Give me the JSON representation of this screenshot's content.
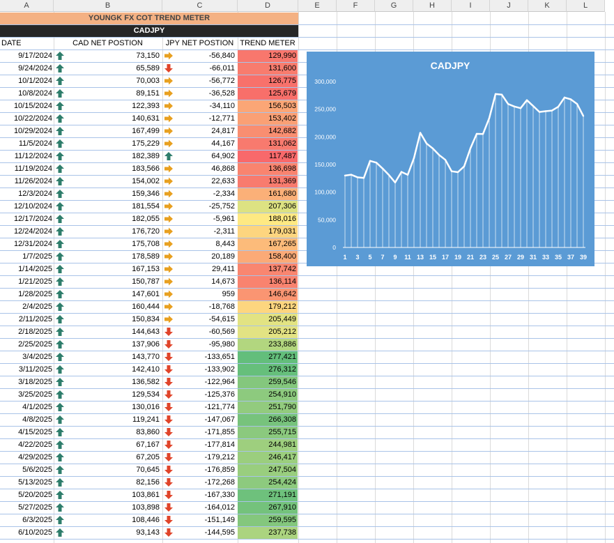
{
  "columns": [
    "A",
    "B",
    "C",
    "D",
    "E",
    "F",
    "G",
    "H",
    "I",
    "J",
    "K",
    "L"
  ],
  "title": "YOUNGK FX COT TREND METER",
  "pair": "CADJPY",
  "headers": {
    "date": "DATE",
    "cad": "CAD NET POSTION",
    "jpy": "JPY NET POSTION",
    "trend": "TREND METER"
  },
  "colors": {
    "up_arrow": "#2e7d6b",
    "down_arrow": "#e0442a",
    "side_arrow": "#e8a020",
    "chart_bg": "#5b9bd5",
    "title_bg": "#f4b183",
    "pair_bg": "#262626"
  },
  "rows": [
    {
      "date": "9/17/2024",
      "cad": "73,150",
      "cad_icon": "up",
      "jpy": "-56,840",
      "jpy_icon": "side",
      "trend": "129,990",
      "trend_color": "#f8776d"
    },
    {
      "date": "9/24/2024",
      "cad": "65,589",
      "cad_icon": "up",
      "jpy": "-66,011",
      "jpy_icon": "down",
      "trend": "131,600",
      "trend_color": "#f87c6e"
    },
    {
      "date": "10/1/2024",
      "cad": "70,003",
      "cad_icon": "up",
      "jpy": "-56,772",
      "jpy_icon": "side",
      "trend": "126,775",
      "trend_color": "#f8716b"
    },
    {
      "date": "10/8/2024",
      "cad": "89,151",
      "cad_icon": "up",
      "jpy": "-36,528",
      "jpy_icon": "side",
      "trend": "125,679",
      "trend_color": "#f86f6a"
    },
    {
      "date": "10/15/2024",
      "cad": "122,393",
      "cad_icon": "up",
      "jpy": "-34,110",
      "jpy_icon": "side",
      "trend": "156,503",
      "trend_color": "#fba676"
    },
    {
      "date": "10/22/2024",
      "cad": "140,631",
      "cad_icon": "up",
      "jpy": "-12,771",
      "jpy_icon": "side",
      "trend": "153,402",
      "trend_color": "#faa075"
    },
    {
      "date": "10/29/2024",
      "cad": "167,499",
      "cad_icon": "up",
      "jpy": "24,817",
      "jpy_icon": "side",
      "trend": "142,682",
      "trend_color": "#f98e71"
    },
    {
      "date": "11/5/2024",
      "cad": "175,229",
      "cad_icon": "up",
      "jpy": "44,167",
      "jpy_icon": "side",
      "trend": "131,062",
      "trend_color": "#f87a6e"
    },
    {
      "date": "11/12/2024",
      "cad": "182,389",
      "cad_icon": "up",
      "jpy": "64,902",
      "jpy_icon": "up",
      "trend": "117,487",
      "trend_color": "#f8696b"
    },
    {
      "date": "11/19/2024",
      "cad": "183,566",
      "cad_icon": "up",
      "jpy": "46,868",
      "jpy_icon": "side",
      "trend": "136,698",
      "trend_color": "#f9846f"
    },
    {
      "date": "11/26/2024",
      "cad": "154,002",
      "cad_icon": "up",
      "jpy": "22,633",
      "jpy_icon": "side",
      "trend": "131,369",
      "trend_color": "#f87b6e"
    },
    {
      "date": "12/3/2024",
      "cad": "159,346",
      "cad_icon": "up",
      "jpy": "-2,334",
      "jpy_icon": "side",
      "trend": "161,680",
      "trend_color": "#fbb078"
    },
    {
      "date": "12/10/2024",
      "cad": "181,554",
      "cad_icon": "up",
      "jpy": "-25,752",
      "jpy_icon": "side",
      "trend": "207,306",
      "trend_color": "#dde282"
    },
    {
      "date": "12/17/2024",
      "cad": "182,055",
      "cad_icon": "up",
      "jpy": "-5,961",
      "jpy_icon": "side",
      "trend": "188,016",
      "trend_color": "#fee983"
    },
    {
      "date": "12/24/2024",
      "cad": "176,720",
      "cad_icon": "up",
      "jpy": "-2,311",
      "jpy_icon": "side",
      "trend": "179,031",
      "trend_color": "#fdd57f"
    },
    {
      "date": "12/31/2024",
      "cad": "175,708",
      "cad_icon": "up",
      "jpy": "8,443",
      "jpy_icon": "side",
      "trend": "167,265",
      "trend_color": "#fcbb7a"
    },
    {
      "date": "1/7/2025",
      "cad": "178,589",
      "cad_icon": "up",
      "jpy": "20,189",
      "jpy_icon": "side",
      "trend": "158,400",
      "trend_color": "#fbaa77"
    },
    {
      "date": "1/14/2025",
      "cad": "167,153",
      "cad_icon": "up",
      "jpy": "29,411",
      "jpy_icon": "side",
      "trend": "137,742",
      "trend_color": "#f98670"
    },
    {
      "date": "1/21/2025",
      "cad": "150,787",
      "cad_icon": "up",
      "jpy": "14,673",
      "jpy_icon": "side",
      "trend": "136,114",
      "trend_color": "#f9836f"
    },
    {
      "date": "1/28/2025",
      "cad": "147,601",
      "cad_icon": "up",
      "jpy": "959",
      "jpy_icon": "side",
      "trend": "146,642",
      "trend_color": "#fa9572"
    },
    {
      "date": "2/4/2025",
      "cad": "160,444",
      "cad_icon": "up",
      "jpy": "-18,768",
      "jpy_icon": "side",
      "trend": "179,212",
      "trend_color": "#fdd67f"
    },
    {
      "date": "2/11/2025",
      "cad": "150,834",
      "cad_icon": "up",
      "jpy": "-54,615",
      "jpy_icon": "side",
      "trend": "205,449",
      "trend_color": "#e2e383"
    },
    {
      "date": "2/18/2025",
      "cad": "144,643",
      "cad_icon": "up",
      "jpy": "-60,569",
      "jpy_icon": "down",
      "trend": "205,212",
      "trend_color": "#e3e383"
    },
    {
      "date": "2/25/2025",
      "cad": "137,906",
      "cad_icon": "up",
      "jpy": "-95,980",
      "jpy_icon": "down",
      "trend": "233,886",
      "trend_color": "#b2d67f"
    },
    {
      "date": "3/4/2025",
      "cad": "143,770",
      "cad_icon": "up",
      "jpy": "-133,651",
      "jpy_icon": "down",
      "trend": "277,421",
      "trend_color": "#63be7b"
    },
    {
      "date": "3/11/2025",
      "cad": "142,410",
      "cad_icon": "up",
      "jpy": "-133,902",
      "jpy_icon": "down",
      "trend": "276,312",
      "trend_color": "#66bf7b"
    },
    {
      "date": "3/18/2025",
      "cad": "136,582",
      "cad_icon": "up",
      "jpy": "-122,964",
      "jpy_icon": "down",
      "trend": "259,546",
      "trend_color": "#84c77d"
    },
    {
      "date": "3/25/2025",
      "cad": "129,534",
      "cad_icon": "up",
      "jpy": "-125,376",
      "jpy_icon": "down",
      "trend": "254,910",
      "trend_color": "#8dca7e"
    },
    {
      "date": "4/1/2025",
      "cad": "130,016",
      "cad_icon": "up",
      "jpy": "-121,774",
      "jpy_icon": "down",
      "trend": "251,790",
      "trend_color": "#92cb7e"
    },
    {
      "date": "4/8/2025",
      "cad": "119,241",
      "cad_icon": "up",
      "jpy": "-147,067",
      "jpy_icon": "down",
      "trend": "266,308",
      "trend_color": "#77c37c"
    },
    {
      "date": "4/15/2025",
      "cad": "83,860",
      "cad_icon": "up",
      "jpy": "-171,855",
      "jpy_icon": "down",
      "trend": "255,715",
      "trend_color": "#8bc97e"
    },
    {
      "date": "4/22/2025",
      "cad": "67,167",
      "cad_icon": "up",
      "jpy": "-177,814",
      "jpy_icon": "down",
      "trend": "244,981",
      "trend_color": "#9ecf7e"
    },
    {
      "date": "4/29/2025",
      "cad": "67,205",
      "cad_icon": "up",
      "jpy": "-179,212",
      "jpy_icon": "down",
      "trend": "246,417",
      "trend_color": "#9bce7e"
    },
    {
      "date": "5/6/2025",
      "cad": "70,645",
      "cad_icon": "up",
      "jpy": "-176,859",
      "jpy_icon": "down",
      "trend": "247,504",
      "trend_color": "#99ce7e"
    },
    {
      "date": "5/13/2025",
      "cad": "82,156",
      "cad_icon": "up",
      "jpy": "-172,268",
      "jpy_icon": "down",
      "trend": "254,424",
      "trend_color": "#8dca7e"
    },
    {
      "date": "5/20/2025",
      "cad": "103,861",
      "cad_icon": "up",
      "jpy": "-167,330",
      "jpy_icon": "down",
      "trend": "271,191",
      "trend_color": "#6ec17c"
    },
    {
      "date": "5/27/2025",
      "cad": "103,898",
      "cad_icon": "up",
      "jpy": "-164,012",
      "jpy_icon": "down",
      "trend": "267,910",
      "trend_color": "#74c27c"
    },
    {
      "date": "6/3/2025",
      "cad": "108,446",
      "cad_icon": "up",
      "jpy": "-151,149",
      "jpy_icon": "down",
      "trend": "259,595",
      "trend_color": "#84c77d"
    },
    {
      "date": "6/10/2025",
      "cad": "93,143",
      "cad_icon": "up",
      "jpy": "-144,595",
      "jpy_icon": "down",
      "trend": "237,738",
      "trend_color": "#abd47f"
    }
  ],
  "chart_data": {
    "type": "area",
    "title": "CADJPY",
    "xlabel": "",
    "ylabel": "",
    "x": [
      1,
      2,
      3,
      4,
      5,
      6,
      7,
      8,
      9,
      10,
      11,
      12,
      13,
      14,
      15,
      16,
      17,
      18,
      19,
      20,
      21,
      22,
      23,
      24,
      25,
      26,
      27,
      28,
      29,
      30,
      31,
      32,
      33,
      34,
      35,
      36,
      37,
      38,
      39
    ],
    "x_tick_labels": [
      "1",
      "3",
      "5",
      "7",
      "9",
      "11",
      "13",
      "15",
      "17",
      "19",
      "21",
      "23",
      "25",
      "27",
      "29",
      "31",
      "33",
      "35",
      "37",
      "39"
    ],
    "values": [
      129990,
      131600,
      126775,
      125679,
      156503,
      153402,
      142682,
      131062,
      117487,
      136698,
      131369,
      161680,
      207306,
      188016,
      179031,
      167265,
      158400,
      137742,
      136114,
      146642,
      179212,
      205449,
      205212,
      233886,
      277421,
      276312,
      259546,
      254910,
      251790,
      266308,
      255715,
      244981,
      246417,
      247504,
      254424,
      271191,
      267910,
      259595,
      237738
    ],
    "y_tick_labels": [
      "0",
      "50,000",
      "100,000",
      "150,000",
      "200,000",
      "250,000",
      "300,000"
    ],
    "ylim": [
      0,
      300000
    ],
    "grid": false,
    "legend": "none",
    "line_color": "#ffffff",
    "background": "#5b9bd5"
  }
}
